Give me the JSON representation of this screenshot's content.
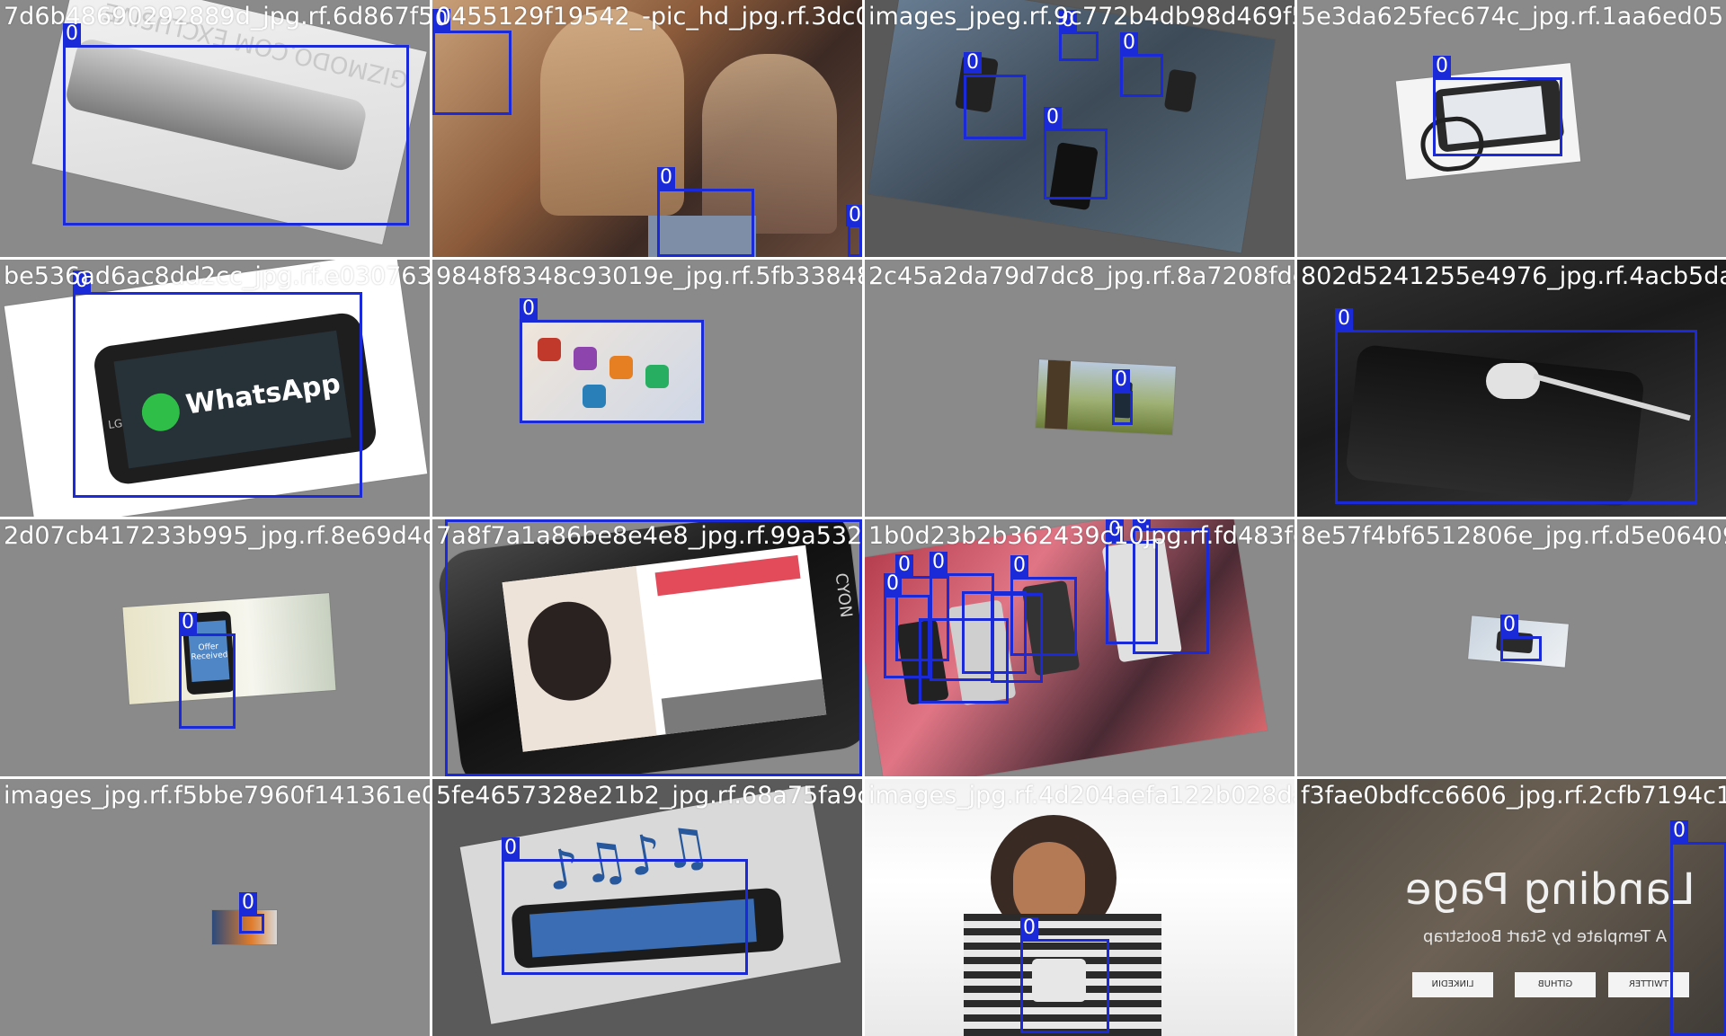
{
  "class_label": "0",
  "box_color": "#1a2ad8",
  "tiles": [
    {
      "filename": "7d6b48690292889d_jpg.rf.6d867f5c048c5252"
    },
    {
      "filename": "0455129f19542_-pic_hd_jpg.rf.3dc094e2c4"
    },
    {
      "filename": "images_jpeg.rf.9c772b4db98d469f57e2d3a6"
    },
    {
      "filename": "5e3da625fec674c_jpg.rf.1aa6ed05"
    },
    {
      "filename": "be536ad6ac8dd2cc_jpg.rf.e0307633f3486f3"
    },
    {
      "filename": "9848f8348c93019e_jpg.rf.5fb338487045f7a"
    },
    {
      "filename": "2c45a2da79d7dc8_jpg.rf.8a7208fdc80b52124"
    },
    {
      "filename": "802d5241255e4976_jpg.rf.4acb5da9"
    },
    {
      "filename": "2d07cb417233b995_jpg.rf.8e69d4d7a8f7a1a"
    },
    {
      "filename": "7a8f7a1a86be8e4e8_jpg.rf.99a5329fd5e2952"
    },
    {
      "filename": "1b0d23b2b362439c10jpg.rf.fd483fcef6e5724"
    },
    {
      "filename": "8e57f4bf6512806e_jpg.rf.d5e06409"
    },
    {
      "filename": "images_jpg.rf.f5bbe7960f141361e04842a3b"
    },
    {
      "filename": "5fe4657328e21b2_jpg.rf.68a75fa9c26b4b"
    },
    {
      "filename": "images_jpg.rf.4d204aefa122b028da73ea2b6"
    },
    {
      "filename": "f3fae0bdfcc6606_jpg.rf.2cfb7194c1"
    }
  ],
  "photo_texts": {
    "whatsapp": "WhatsApp",
    "landing_title": "Landing Page",
    "landing_sub": "A Template by Start Bootstrap",
    "offer": "Offer Received",
    "brand_lg": "LG",
    "watermark": "GIZMODO.COM EXCLUSIVE",
    "cyon": "CYON",
    "twitter": "TWITTER",
    "github": "GITHUB",
    "linkedin": "LINKEDIN"
  }
}
